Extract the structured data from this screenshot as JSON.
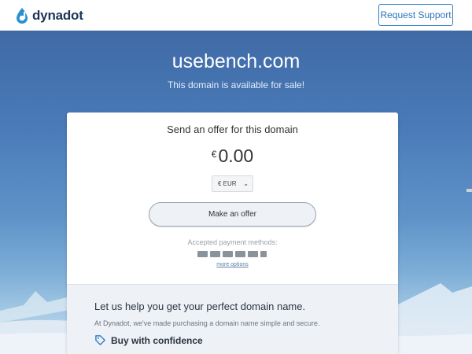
{
  "header": {
    "logo_text": "dynadot",
    "support_label": "Request Support"
  },
  "hero": {
    "domain": "usebench.com",
    "subtitle": "This domain is available for sale!"
  },
  "offer_card": {
    "heading": "Send an offer for this domain",
    "currency_symbol": "€",
    "amount": "0.00",
    "currency_select": "€ EUR",
    "offer_button": "Make an offer",
    "accepted_label": "Accepted payment methods:",
    "payment_methods": [
      "VISA",
      "MC",
      "AMEX",
      "DISC",
      "BANK",
      "PAYPAL"
    ],
    "more_options": "more options"
  },
  "help": {
    "title": "Let us help you get your perfect domain name.",
    "text": "At Dynadot, we've made purchasing a domain name simple and secure.",
    "feature": "Buy with confidence"
  },
  "colors": {
    "accent": "#2f80c7",
    "brand_dark": "#1d3557"
  }
}
